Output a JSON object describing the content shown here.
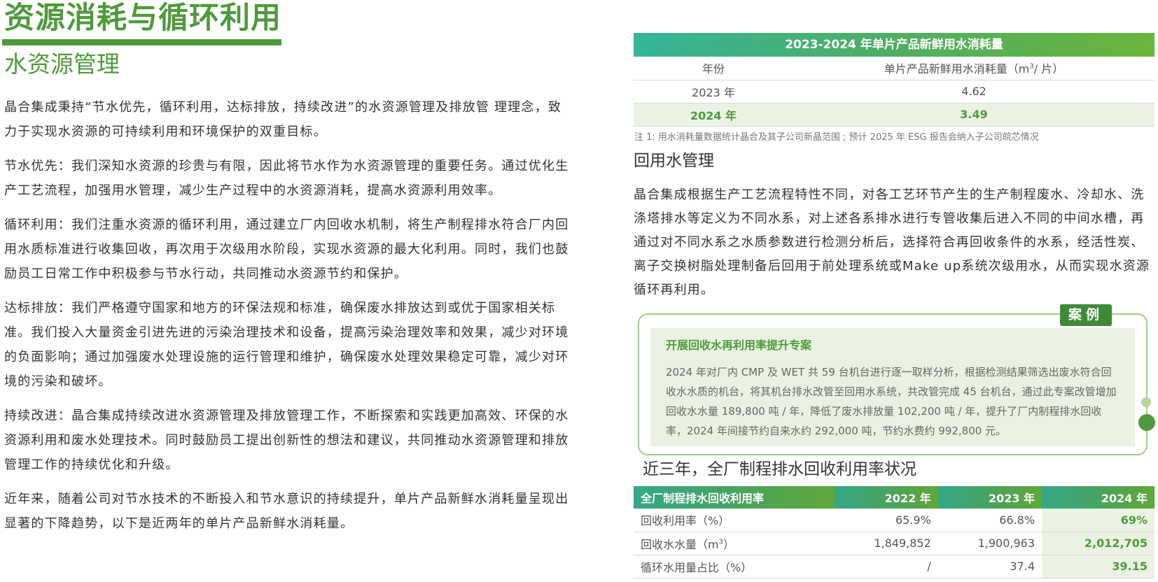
{
  "main_title": "资源消耗与循环利用",
  "section_title": "水资源管理",
  "paragraphs": [
    "晶合集成秉持“节水优先，循环利用，达标排放，持续改进”的水资源管理及排放管 理理念，致力于实现水资源的可持续利用和环境保护的双重目标。",
    "节水优先：我们深知水资源的珍贵与有限，因此将节水作为水资源管理的重要任务。通过优化生产工艺流程，加强用水管理，减少生产过程中的水资源消耗，提高水资源利用效率。",
    "循环利用：我们注重水资源的循环利用，通过建立厂内回收水机制，将生产制程排水符合厂内回用水质标准进行收集回收，再次用于次级用水阶段，实现水资源的最大化利用。同时，我们也鼓励员工日常工作中积极参与节水行动，共同推动水资源节约和保护。",
    "达标排放：我们严格遵守国家和地方的环保法规和标准，确保废水排放达到或优于国家相关标准。我们投入大量资金引进先进的污染治理技术和设备，提高污染治理效率和效果，减少对环境的负面影响；通过加强废水处理设施的运行管理和维护，确保废水处理效果稳定可靠，减少对环境的污染和破坏。",
    "持续改进：晶合集成持续改进水资源管理及排放管理工作，不断探索和实践更加高效、环保的水资源利用和废水处理技术。同时鼓励员工提出创新性的想法和建议，共同推动水资源管理和排放管理工作的持续优化和升级。",
    "近年来，随着公司对节水技术的不断投入和节水意识的持续提升，单片产品新鲜水消耗量呈现出显著的下降趋势，以下是近两年的单片产品新鲜水消耗量。"
  ],
  "water_table": {
    "title": "2023-2024 年单片产品新鲜用水消耗量",
    "col_year": "年份",
    "col_value_prefix": "单片产品新鲜用水消耗量（m",
    "col_value_sup": "3",
    "col_value_suffix": "/ 片）",
    "rows": [
      {
        "year": "2023 年",
        "value": "4.62"
      },
      {
        "year": "2024 年",
        "value": "3.49"
      }
    ],
    "note": "注 1: 用水消耗量数据统计晶合及其子公司新晶范围 ; 预计 2025 年 ESG 报告会纳入子公司皖芯情况"
  },
  "reuse_title": "回用水管理",
  "reuse_text": "晶合集成根据生产工艺流程特性不同，对各工艺环节产生的生产制程废水、冷却水、洗涤塔排水等定义为不同水系，对上述各系排水进行专管收集后进入不同的中间水槽，再通过对不同水系之水质参数进行检测分析后，选择符合再回收条件的水系，经活性炭、离子交换树脂处理制备后回用于前处理系统或Make up系统次级用水，从而实现水资源循环再利用。",
  "case": {
    "tag": "案例",
    "title": "开展回收水再利用率提升专案",
    "body": "2024 年对厂内 CMP 及 WET 共 59 台机台进行逐一取样分析，根据检测结果筛选出废水符合回收水水质的机台，将其机台排水改管至回用水系统，共改管完成 45 台机台，通过此专案改管增加回收水水量 189,800 吨 / 年，降低了废水排放量 102,200 吨 / 年，提升了厂内制程排水回收率，2024 年间接节约自来水约 292,000 吨，节约水费约 992,800 元。"
  },
  "recovery": {
    "title": "近三年，全厂制程排水回收利用率状况",
    "headers": [
      "全厂制程排水回收利用率",
      "2022 年",
      "2023 年",
      "2024 年"
    ],
    "rows": [
      {
        "label": "回收利用率（%）",
        "label_sup": "",
        "label_suffix": "",
        "v2022": "65.9%",
        "v2023": "66.8%",
        "v2024": "69%"
      },
      {
        "label": "回收水水量（m",
        "label_sup": "3",
        "label_suffix": "）",
        "v2022": "1,849,852",
        "v2023": "1,900,963",
        "v2024": "2,012,705"
      },
      {
        "label": "循环水用量占比（%）",
        "label_sup": "",
        "label_suffix": "",
        "v2022": "/",
        "v2023": "37.4",
        "v2024": "39.15"
      }
    ]
  },
  "colors": {
    "brand_green": "#4f9a3c",
    "highlight_bg": "#eaf3e3",
    "accent_teal": "#35b59a"
  }
}
